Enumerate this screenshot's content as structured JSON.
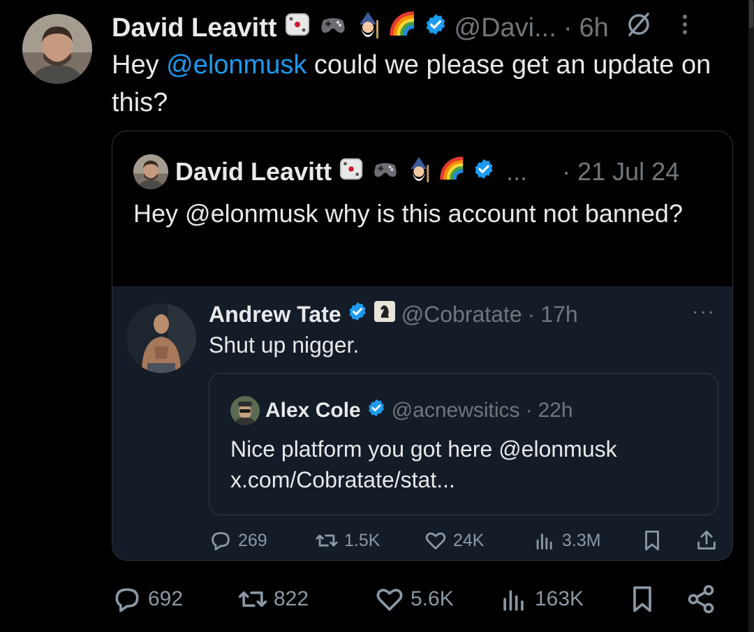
{
  "main_tweet": {
    "author_name": "David Leavitt",
    "handle": "@Davi...",
    "separator": "·",
    "time": "6h",
    "text_prefix": "Hey ",
    "mention": "@elonmusk",
    "text_suffix": " could we please get an update on this?"
  },
  "quoted_tweet": {
    "author_name": "David Leavitt",
    "ellipsis": "...",
    "separator": "·",
    "date": "21 Jul 24",
    "text": "Hey @elonmusk why is this account not banned?"
  },
  "embedded_tweet": {
    "author_name": "Andrew Tate",
    "handle": "@Cobratate",
    "separator": "·",
    "time": "17h",
    "more": "···",
    "text": "Shut up nigger."
  },
  "inner_quote": {
    "author_name": "Alex Cole",
    "handle": "@acnewsitics",
    "separator": "·",
    "time": "22h",
    "text_line1": "Nice platform you got here @elonmusk",
    "text_line2": "x.com/Cobratate/stat..."
  },
  "embedded_actions": {
    "replies": "269",
    "reposts": "1.5K",
    "likes": "24K",
    "views": "3.3M"
  },
  "main_actions": {
    "replies": "692",
    "reposts": "822",
    "likes": "5.6K",
    "views": "163K"
  },
  "colors": {
    "background": "#000000",
    "text": "#e7e9ea",
    "muted": "#71767b",
    "accent": "#1d9bf0",
    "embed_background": "#141c28"
  }
}
